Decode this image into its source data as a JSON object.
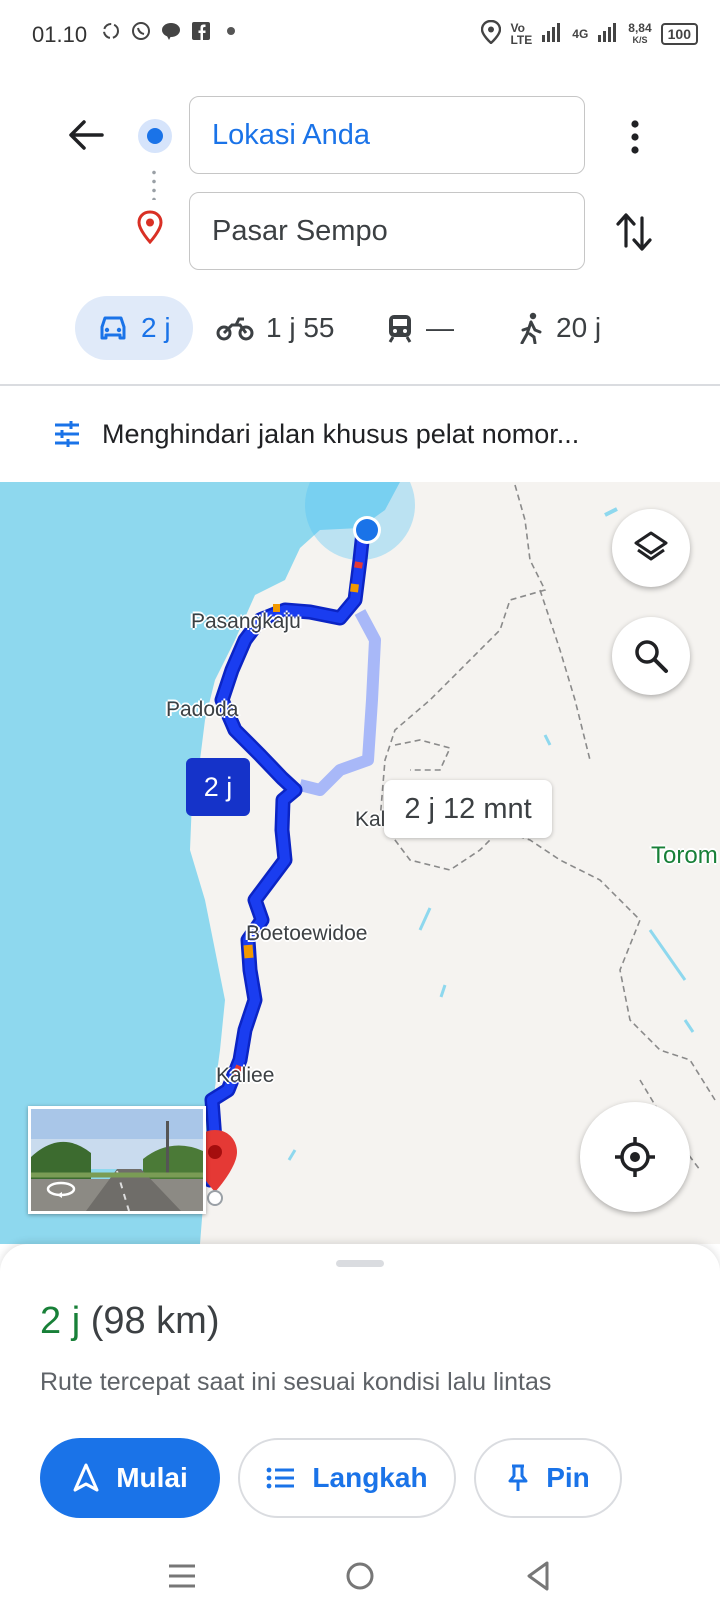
{
  "status_bar": {
    "time": "01.10",
    "left_icons": [
      "sync-icon",
      "whatsapp-icon",
      "line-icon",
      "facebook-icon",
      "dot-icon"
    ],
    "network_label_top": "Vo",
    "network_label_bottom": "LTE",
    "net_type": "4G",
    "speed_value": "8,84",
    "speed_unit": "K/S",
    "battery": "100"
  },
  "header": {
    "origin": "Lokasi Anda",
    "destination": "Pasar Sempo"
  },
  "modes": [
    {
      "icon": "car-icon",
      "label": "2 j",
      "active": true
    },
    {
      "icon": "motorcycle-icon",
      "label": "1 j 55",
      "active": false
    },
    {
      "icon": "transit-icon",
      "label": "—",
      "active": false
    },
    {
      "icon": "walk-icon",
      "label": "20 j",
      "active": false
    }
  ],
  "options": {
    "text": "Menghindari jalan khusus pelat nomor..."
  },
  "map": {
    "places": {
      "p1": "Pasangkaju",
      "p2": "Padoda",
      "p3": "Boetoewidoe",
      "p4": "Kaliee",
      "p5": "Kal",
      "p6": "Torom"
    },
    "route_badge": "2 j",
    "alt_route_label": "2 j 12 mnt",
    "colors": {
      "route": "#1a3df0",
      "alt_route": "#a8b8f8",
      "water": "#8ed8ee",
      "land": "#f5f3f0",
      "park_label": "#188038"
    }
  },
  "sheet": {
    "duration": "2 j",
    "distance": "(98 km)",
    "subtitle": "Rute tercepat saat ini sesuai kondisi lalu lintas",
    "start_label": "Mulai",
    "steps_label": "Langkah",
    "pin_label": "Pin"
  }
}
